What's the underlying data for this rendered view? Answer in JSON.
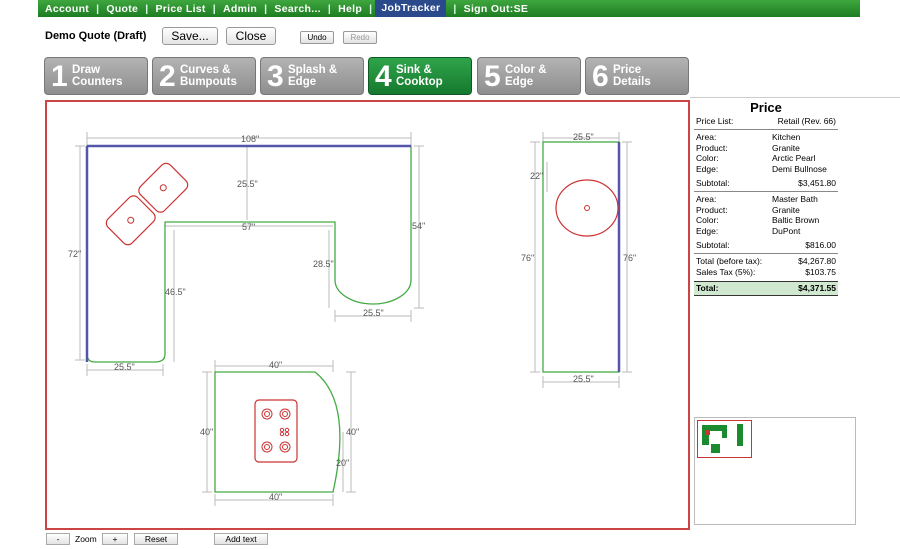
{
  "nav": {
    "items": [
      "Account",
      "Quote",
      "Price List",
      "Admin",
      "Search...",
      "Help",
      "JobTracker",
      "Sign Out:SE"
    ],
    "active": "JobTracker"
  },
  "quote": {
    "title": "Demo Quote (Draft)"
  },
  "toolbar": {
    "save_label": "Save...",
    "close_label": "Close",
    "undo_label": "Undo",
    "redo_label": "Redo"
  },
  "steps": [
    {
      "num": "1",
      "line1": "Draw",
      "line2": "Counters",
      "active": false
    },
    {
      "num": "2",
      "line1": "Curves &",
      "line2": "Bumpouts",
      "active": false
    },
    {
      "num": "3",
      "line1": "Splash &",
      "line2": "Edge",
      "active": false
    },
    {
      "num": "4",
      "line1": "Sink &",
      "line2": "Cooktop",
      "active": true
    },
    {
      "num": "5",
      "line1": "Color &",
      "line2": "Edge",
      "active": false
    },
    {
      "num": "6",
      "line1": "Price",
      "line2": "Details",
      "active": false
    }
  ],
  "dimensions": {
    "l_top": "108\"",
    "l_left": "72\"",
    "l_right": "54\"",
    "l_sink_depth": "25.5\"",
    "l_inner_top": "57\"",
    "l_inner_left": "46.5\"",
    "l_inner_right": "28.5\"",
    "l_bottom_left": "25.5\"",
    "l_bottom_right": "25.5\"",
    "r_top": "25.5\"",
    "r_sink": "22\"",
    "r_left": "76\"",
    "r_right": "76\"",
    "r_bottom": "25.5\"",
    "i_top": "40\"",
    "i_left": "40\"",
    "i_right": "40\"",
    "i_curve": "20\"",
    "i_bottom": "40\""
  },
  "price": {
    "title": "Price",
    "price_list_label": "Price List:",
    "price_list_value": "Retail (Rev. 66)",
    "area_label": "Area:",
    "product_label": "Product:",
    "color_label": "Color:",
    "edge_label": "Edge:",
    "subtotal_label": "Subtotal:",
    "areas": [
      {
        "area": "Kitchen",
        "product": "Granite",
        "color": "Arctic Pearl",
        "edge": "Demi Bullnose",
        "subtotal": "$3,451.80"
      },
      {
        "area": "Master Bath",
        "product": "Granite",
        "color": "Baltic Brown",
        "edge": "DuPont",
        "subtotal": "$816.00"
      }
    ],
    "total_before_tax_label": "Total (before tax):",
    "total_before_tax": "$4,267.80",
    "tax_label": "Sales Tax (5%):",
    "tax": "$103.75",
    "total_label": "Total:",
    "total": "$4,371.55"
  },
  "zoom": {
    "minus": "-",
    "label": "Zoom",
    "plus": "+",
    "reset": "Reset",
    "add_text": "Add text"
  },
  "colors": {
    "nav_green": "#2e9a36",
    "nav_active": "#2a4a8c",
    "counter_outline": "#44aa44",
    "sink_outline": "#cc3333",
    "backsplash": "#5555aa",
    "dimension": "#999999"
  }
}
